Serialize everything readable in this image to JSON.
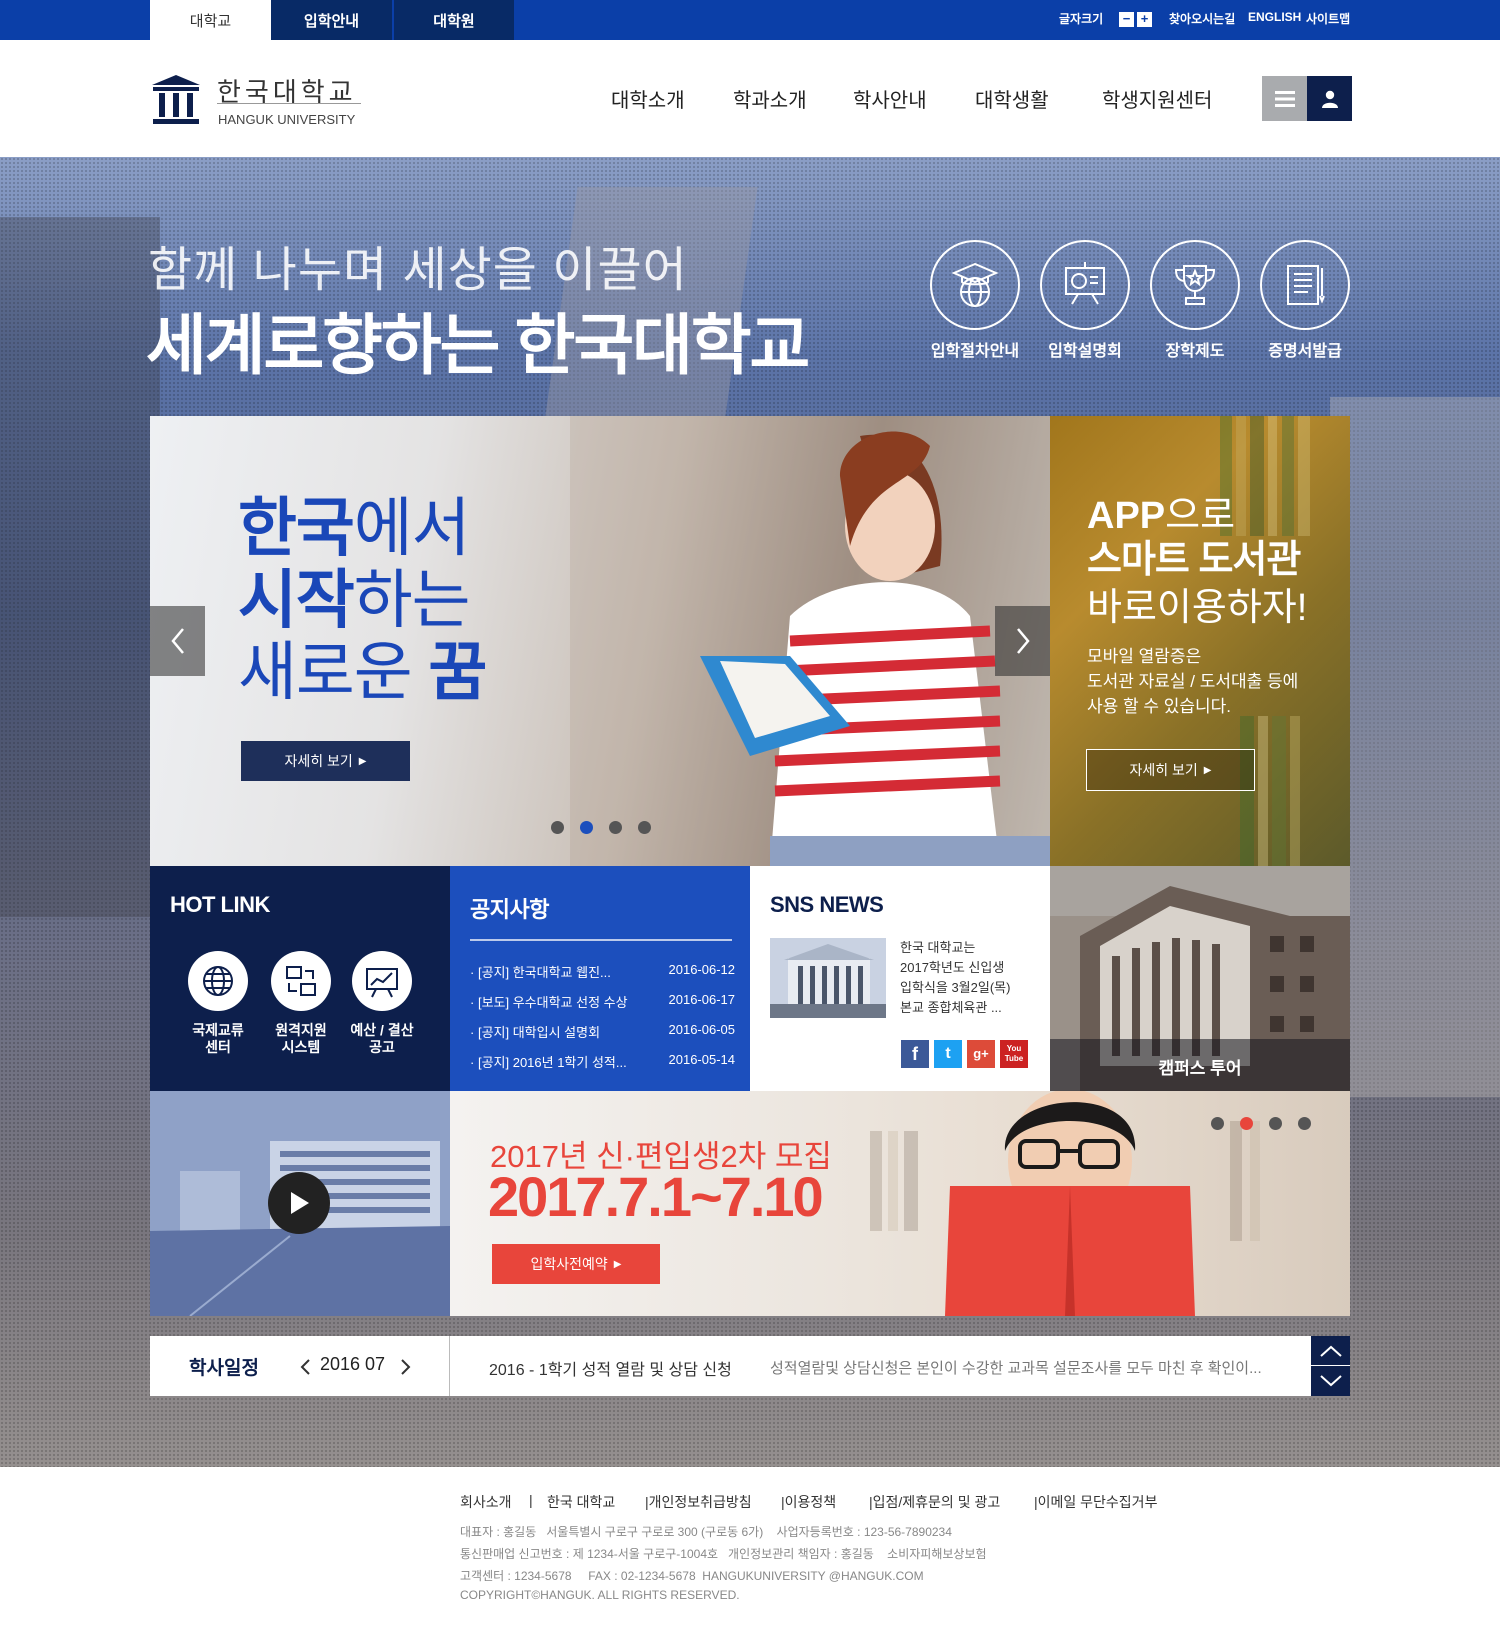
{
  "top_tabs": [
    "대학교",
    "입학안내",
    "대학원"
  ],
  "utility": {
    "font_size_label": "글자크기",
    "font_minus": "−",
    "font_plus": "+",
    "directions": "찾아오시는길",
    "english": "ENGLISH",
    "sitemap": "사이트맵"
  },
  "logo": {
    "name_ko": "한국대학교",
    "name_en": "HANGUK UNIVERSITY"
  },
  "gnb": [
    "대학소개",
    "학과소개",
    "학사안내",
    "대학생활",
    "학생지원센터"
  ],
  "hero": {
    "subtitle": "함께 나누며 세상을 이끌어",
    "title": "세계로향하는 한국대학교"
  },
  "quick_links": [
    {
      "label": "입학절차안내",
      "icon": "graduation-globe-icon"
    },
    {
      "label": "입학설명회",
      "icon": "presentation-board-icon"
    },
    {
      "label": "장학제도",
      "icon": "trophy-icon"
    },
    {
      "label": "증명서발급",
      "icon": "certificate-icon"
    }
  ],
  "slide": {
    "line1_bold": "한국",
    "line1_rest": "에서",
    "line2_bold": "시작",
    "line2_rest": "하는",
    "line3": "새로운 ",
    "line3_bold": "꿈",
    "more": "자세히 보기",
    "active_dot": 1,
    "dot_count": 4
  },
  "app_banner": {
    "line1_bold": "APP",
    "line1_rest": "으로",
    "line2": "스마트 도서관",
    "line3": "바로이용하자!",
    "desc1": "모바일 열람증은",
    "desc2": "도서관 자료실 / 도서대출 등에",
    "desc3": "사용 할 수 있습니다.",
    "more": "자세히 보기"
  },
  "hot_link": {
    "title": "HOT LINK",
    "items": [
      {
        "l1": "국제교류",
        "l2": "센터",
        "icon": "globe-icon"
      },
      {
        "l1": "원격지원",
        "l2": "시스템",
        "icon": "remote-support-icon"
      },
      {
        "l1": "예산 / 결산",
        "l2": "공고",
        "icon": "chart-board-icon"
      }
    ]
  },
  "notice": {
    "title": "공지사항",
    "items": [
      {
        "text": "[공지] 한국대학교 웹진...",
        "date": "2016-06-12"
      },
      {
        "text": "[보도] 우수대학교 선정 수상",
        "date": "2016-06-17"
      },
      {
        "text": "[공지] 대학입시 설명회",
        "date": "2016-06-05"
      },
      {
        "text": "[공지] 2016년 1학기 성적...",
        "date": "2016-05-14"
      }
    ]
  },
  "sns": {
    "title": "SNS NEWS",
    "lines": [
      "한국 대학교는",
      "2017학년도 신입생",
      "입학식을 3월2일(목)",
      "본교 종합체육관 ..."
    ],
    "social": [
      "f",
      "t",
      "g+",
      "You Tube"
    ]
  },
  "campus": {
    "label": "캠퍼스 투어"
  },
  "promo": {
    "title": "2017년 신·편입생2차 모집",
    "date": "2017.7.1~7.10",
    "button": "입학사전예약",
    "active_dot": 1,
    "dot_count": 4
  },
  "schedule": {
    "label": "학사일정",
    "month": "2016 07",
    "headline": "2016 - 1학기 성적 열람 및 상담 신청",
    "detail": "성적열람및 상담신청은 본인이 수강한 교과목 설문조사를 모두 마친 후 확인이..."
  },
  "footer": {
    "links": [
      "회사소개",
      "|",
      "한국 대학교",
      "|개인정보취급방침",
      "|이용정책",
      "|입점/제휴문의 및 광고",
      "|이메일 무단수집거부"
    ],
    "info1": "대표자 : 홍길동   서울특별시 구로구 구로로 300 (구로동 6가)    사업자등록번호 : 123-56-7890234",
    "info2": "통신판매업 신고번호 : 제 1234-서울 구로구-1004호   개인정보관리 책임자 : 홍길동    소비자피해보상보험",
    "info3": "고객센터 : 1234-5678     FAX : 02-1234-5678  HANGUKUNIVERSITY @HANGUK.COM",
    "copyright": "COPYRIGHT©HANGUK. ALL RIGHTS RESERVED."
  },
  "colors": {
    "primary": "#0b3fa8",
    "navy": "#0d1f4c",
    "notice_blue": "#1c4fbd",
    "accent_red": "#e8453b",
    "slide_blue": "#1a47b8"
  }
}
